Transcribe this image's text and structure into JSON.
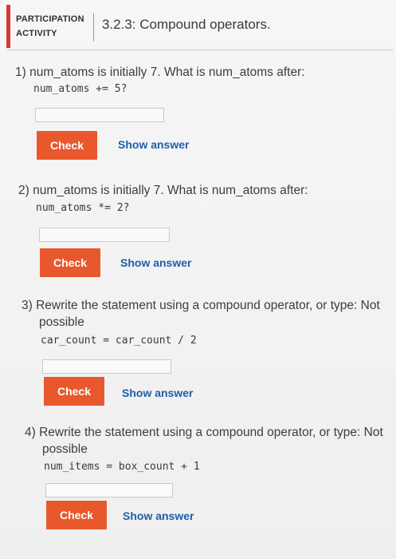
{
  "header": {
    "activity_label_line1": "PARTICIPATION",
    "activity_label_line2": "ACTIVITY",
    "title": "3.2.3: Compound operators."
  },
  "questions": [
    {
      "number": "1)",
      "text": "num_atoms is initially 7. What is num_atoms after:",
      "code": "num_atoms += 5?",
      "check_label": "Check",
      "show_answer_label": "Show answer",
      "input_value": ""
    },
    {
      "number": "2)",
      "text": "num_atoms is initially 7. What is num_atoms after:",
      "code": "num_atoms *= 2?",
      "check_label": "Check",
      "show_answer_label": "Show answer",
      "input_value": ""
    },
    {
      "number": "3)",
      "text_line1": "Rewrite the statement using a compound operator, or type: Not",
      "text_line2": "possible",
      "code": "car_count = car_count / 2",
      "check_label": "Check",
      "show_answer_label": "Show answer",
      "input_value": ""
    },
    {
      "number": "4)",
      "text_line1": "Rewrite the statement using a compound operator, or type: Not",
      "text_line2": "possible",
      "code": "num_items = box_count + 1",
      "check_label": "Check",
      "show_answer_label": "Show answer",
      "input_value": ""
    }
  ],
  "colors": {
    "accent": "#d23a2f",
    "check_button": "#e8582c",
    "link": "#1d5fa8"
  }
}
